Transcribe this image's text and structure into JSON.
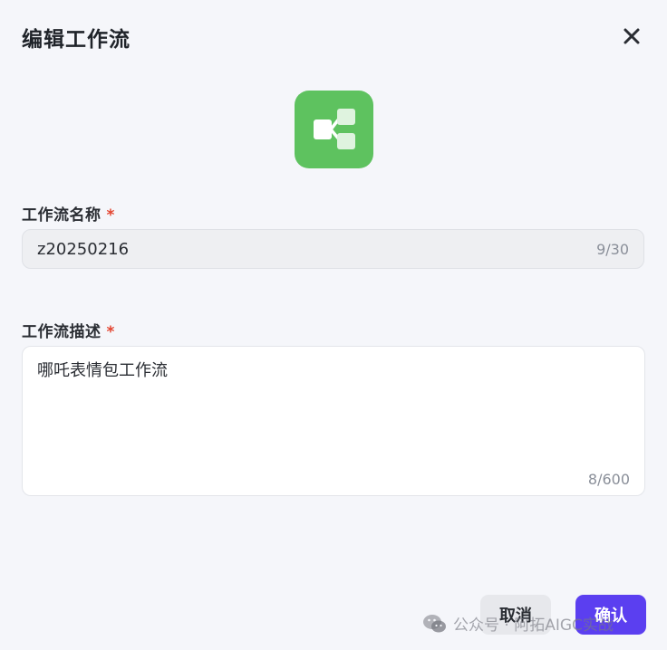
{
  "dialog": {
    "title": "编辑工作流",
    "close_icon": "close-icon"
  },
  "app_icon": {
    "icon": "workflow-icon",
    "background_color": "#5ec25f"
  },
  "name_field": {
    "label": "工作流名称",
    "required_mark": "*",
    "value": "z20250216",
    "counter": "9/30"
  },
  "description_field": {
    "label": "工作流描述",
    "required_mark": "*",
    "value": "哪吒表情包工作流",
    "counter": "8/600"
  },
  "buttons": {
    "cancel_label": "取消",
    "confirm_label": "确认",
    "confirm_color": "#5b3ff0"
  },
  "watermark": {
    "text": "公众号 · 阿拓AIGC实战",
    "icon": "wechat-icon"
  }
}
